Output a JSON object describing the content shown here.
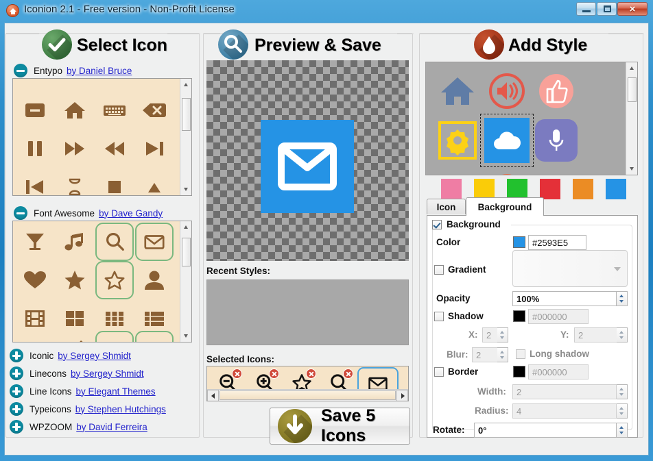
{
  "window": {
    "title": "Iconion 2.1 - Free version - Non-Profit License",
    "app_icon": "home-icon",
    "buttons": {
      "minimize": "minimize-icon",
      "maximize": "maximize-icon",
      "close": "×"
    }
  },
  "panels": {
    "select_icon": {
      "title": "Select Icon",
      "icon": "check-circle-icon"
    },
    "preview_save": {
      "title": "Preview & Save",
      "icon": "magnifier-icon"
    },
    "add_style": {
      "title": "Add Style",
      "icon": "droplet-icon"
    }
  },
  "fonts": {
    "expanded": [
      {
        "name": "Entypo",
        "author": "by Daniel Bruce",
        "toggle": "minus-icon",
        "expanded": true
      },
      {
        "name": "Font Awesome",
        "author": "by Dave Gandy",
        "toggle": "minus-icon",
        "expanded": true
      }
    ],
    "collapsed": [
      {
        "name": "Iconic",
        "author": "by Sergey Shmidt",
        "toggle": "plus-icon"
      },
      {
        "name": "Linecons",
        "author": "by Sergey Shmidt",
        "toggle": "plus-icon"
      },
      {
        "name": "Line Icons",
        "author": "by Elegant Themes",
        "toggle": "plus-icon"
      },
      {
        "name": "Typeicons",
        "author": "by Stephen Hutchings",
        "toggle": "plus-icon"
      },
      {
        "name": "WPZOOM",
        "author": "by David Ferreira",
        "toggle": "plus-icon"
      }
    ]
  },
  "entypo_grid": [
    {
      "icon": "minus-box-icon",
      "selected": false
    },
    {
      "icon": "home-icon",
      "selected": false
    },
    {
      "icon": "keyboard-icon",
      "selected": false
    },
    {
      "icon": "backspace-icon",
      "selected": false
    },
    {
      "icon": "pause-icon",
      "selected": false
    },
    {
      "icon": "fast-forward-icon",
      "selected": false
    },
    {
      "icon": "rewind-icon",
      "selected": false
    },
    {
      "icon": "skip-forward-icon",
      "selected": false
    },
    {
      "icon": "skip-back-icon",
      "selected": false
    },
    {
      "icon": "hourglass-icon",
      "selected": false
    },
    {
      "icon": "stop-square-icon",
      "selected": false
    },
    {
      "icon": "triangle-up-icon",
      "selected": false
    }
  ],
  "fontawesome_grid": [
    {
      "icon": "cocktail-icon",
      "selected": false
    },
    {
      "icon": "music-note-icon",
      "selected": false
    },
    {
      "icon": "search-icon",
      "selected": true
    },
    {
      "icon": "envelope-icon",
      "selected": true
    },
    {
      "icon": "heart-icon",
      "selected": false
    },
    {
      "icon": "star-filled-icon",
      "selected": false
    },
    {
      "icon": "star-outline-icon",
      "selected": true
    },
    {
      "icon": "user-icon",
      "selected": false
    },
    {
      "icon": "film-icon",
      "selected": false
    },
    {
      "icon": "th-large-icon",
      "selected": false
    },
    {
      "icon": "th-grid-icon",
      "selected": false
    },
    {
      "icon": "th-list-icon",
      "selected": false
    },
    {
      "icon": "pencil-icon",
      "selected": false
    },
    {
      "icon": "check-icon",
      "selected": false
    },
    {
      "icon": "zoom-in-icon",
      "selected": true
    },
    {
      "icon": "zoom-out-icon",
      "selected": true
    }
  ],
  "preview": {
    "icon": "envelope-icon",
    "background_color": "#2593E5",
    "icon_color": "#FFFFFF",
    "recent_styles_label": "Recent Styles:",
    "recent_styles": [],
    "selected_icons_label": "Selected Icons:"
  },
  "selected_icons": [
    {
      "icon": "zoom-out-icon",
      "current": false
    },
    {
      "icon": "zoom-in-icon",
      "current": false
    },
    {
      "icon": "star-outline-icon",
      "current": false
    },
    {
      "icon": "search-icon",
      "current": false
    },
    {
      "icon": "envelope-icon",
      "current": true
    }
  ],
  "save": {
    "label": "Save 5 Icons",
    "icon": "download-arrow-icon",
    "count": 5
  },
  "style_presets": [
    {
      "name": "home-blue-gray",
      "current": false
    },
    {
      "name": "volume-red-outline-circle",
      "current": false
    },
    {
      "name": "thumbs-up-pink-circle",
      "current": false
    },
    {
      "name": "gear-yellow-outline-square",
      "current": false
    },
    {
      "name": "cloud-blue-square",
      "current": true
    },
    {
      "name": "microphone-purple-rounded",
      "current": false
    },
    {
      "name": "browser-blue-outline",
      "current": false
    },
    {
      "name": "orange-circle",
      "current": false
    },
    {
      "name": "gray-outline-rounded",
      "current": false
    }
  ],
  "color_swatches": [
    "#EF7DA4",
    "#FACC08",
    "#22C12E",
    "#E43038",
    "#EB8C24",
    "#2593E5"
  ],
  "tabs": [
    {
      "label": "Icon",
      "active": false
    },
    {
      "label": "Background",
      "active": true
    }
  ],
  "background_form": {
    "group_label": "Background",
    "group_checked": true,
    "color_label": "Color",
    "color_value": "#2593E5",
    "color_swatch": "#2593E5",
    "gradient_label": "Gradient",
    "gradient_checked": false,
    "opacity_label": "Opacity",
    "opacity_value": "100%",
    "shadow_label": "Shadow",
    "shadow_checked": false,
    "shadow_color": "#000000",
    "shadow_swatch": "#000000",
    "x_label": "X:",
    "x_value": "2",
    "y_label": "Y:",
    "y_value": "2",
    "blur_label": "Blur:",
    "blur_value": "2",
    "long_shadow_label": "Long shadow",
    "long_shadow_checked": false,
    "border_label": "Border",
    "border_checked": false,
    "border_color": "#000000",
    "border_swatch": "#000000",
    "width_label": "Width:",
    "width_value": "2",
    "radius_label": "Radius:",
    "radius_value": "4",
    "rotate_label": "Rotate:",
    "rotate_value": "0°"
  }
}
